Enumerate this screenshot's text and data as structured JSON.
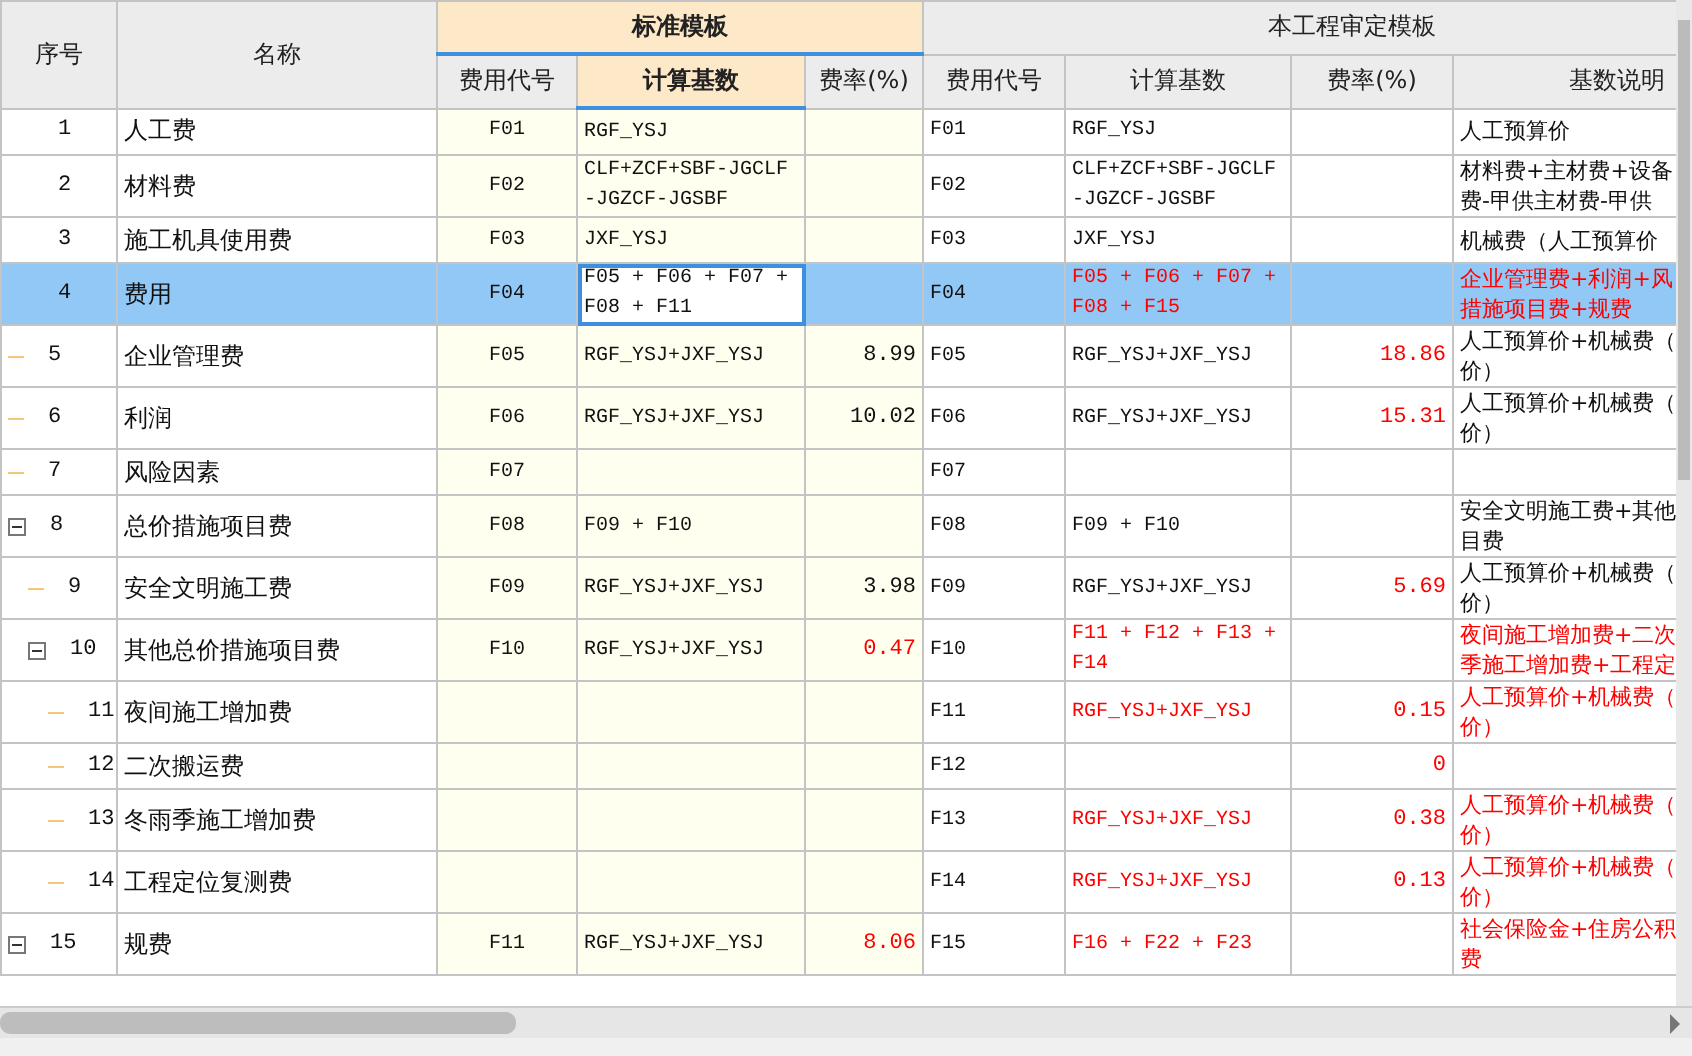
{
  "table": {
    "columns": [
      {
        "label": "序号"
      },
      {
        "label": "名称"
      }
    ],
    "groups": [
      {
        "label": "标准模板",
        "highlighted": true,
        "columns": [
          {
            "label": "费用代号",
            "highlighted": false
          },
          {
            "label": "计算基数",
            "highlighted": true
          },
          {
            "label": "费率(%)",
            "highlighted": false
          }
        ]
      },
      {
        "label": "本工程审定模板",
        "highlighted": false,
        "columns": [
          {
            "label": "费用代号",
            "highlighted": false
          },
          {
            "label": "计算基数",
            "highlighted": false
          },
          {
            "label": "费率(%)",
            "highlighted": false
          },
          {
            "label": "基数说明",
            "highlighted": false
          }
        ]
      }
    ],
    "rows": [
      {
        "seq": "1",
        "name": "人工费",
        "std_code": "F01",
        "std_base": "RGF_YSJ",
        "code": "F01",
        "base": {
          "text": "RGF_YSJ",
          "red": false
        },
        "desc": {
          "lines": [
            "人工预算价"
          ],
          "red": false
        },
        "selected": false,
        "editing": false
      },
      {
        "seq": "2",
        "name": "材料费",
        "std_code": "F02",
        "std_base": "CLF+ZCF+SBF-JGCLF-JGZCF-JGSBF",
        "code": "F02",
        "base": {
          "text": "CLF+ZCF+SBF-JGCLF-JGZCF-JGSBF",
          "red": false
        },
        "desc": {
          "lines": [
            "材料费+主材费+设备",
            "费-甲供主材费-甲供"
          ],
          "red": false
        },
        "selected": false,
        "editing": false
      },
      {
        "seq": "3",
        "name": "施工机具使用费",
        "std_code": "F03",
        "std_base": "JXF_YSJ",
        "code": "F03",
        "base": {
          "text": "JXF_YSJ",
          "red": false
        },
        "desc": {
          "lines": [
            "机械费（人工预算价"
          ],
          "red": false
        },
        "selected": false,
        "editing": false
      },
      {
        "seq": "4",
        "name": "费用",
        "std_code": "F04",
        "std_base": "F05 + F06 + F07 + F08 + F11",
        "code": "F04",
        "base": {
          "text": "F05 + F06 + F07 + F08 + F15",
          "red": true
        },
        "desc": {
          "lines": [
            "企业管理费+利润+风",
            "措施项目费+规费"
          ],
          "red": true
        },
        "selected": true,
        "editing": true,
        "children": [
          {
            "seq": "5",
            "name": "企业管理费",
            "std_code": "F05",
            "std_base": "RGF_YSJ+JXF_YSJ",
            "std_rate": {
              "text": "8.99",
              "red": false
            },
            "code": "F05",
            "base": {
              "text": "RGF_YSJ+JXF_YSJ",
              "red": false
            },
            "rate": {
              "text": "18.86",
              "red": true
            },
            "desc": {
              "lines": [
                "人工预算价+机械费（",
                "价）"
              ],
              "red": false
            },
            "selected": false,
            "editing": false
          },
          {
            "seq": "6",
            "name": "利润",
            "std_code": "F06",
            "std_base": "RGF_YSJ+JXF_YSJ",
            "std_rate": {
              "text": "10.02",
              "red": false
            },
            "code": "F06",
            "base": {
              "text": "RGF_YSJ+JXF_YSJ",
              "red": false
            },
            "rate": {
              "text": "15.31",
              "red": true
            },
            "desc": {
              "lines": [
                "人工预算价+机械费（",
                "价）"
              ],
              "red": false
            },
            "selected": false,
            "editing": false
          },
          {
            "seq": "7",
            "name": "风险因素",
            "std_code": "F07",
            "code": "F07",
            "selected": false,
            "editing": false
          },
          {
            "seq": "8",
            "name": "总价措施项目费",
            "std_code": "F08",
            "std_base": "F09 + F10",
            "code": "F08",
            "base": {
              "text": "F09 + F10",
              "red": false
            },
            "desc": {
              "lines": [
                "安全文明施工费+其他",
                "目费"
              ],
              "red": false
            },
            "selected": false,
            "editing": false,
            "expanded": true,
            "children": [
              {
                "seq": "9",
                "name": "安全文明施工费",
                "std_code": "F09",
                "std_base": "RGF_YSJ+JXF_YSJ",
                "std_rate": {
                  "text": "3.98",
                  "red": false
                },
                "code": "F09",
                "base": {
                  "text": "RGF_YSJ+JXF_YSJ",
                  "red": false
                },
                "rate": {
                  "text": "5.69",
                  "red": true
                },
                "desc": {
                  "lines": [
                    "人工预算价+机械费（",
                    "价）"
                  ],
                  "red": false
                },
                "selected": false,
                "editing": false
              },
              {
                "seq": "10",
                "name": "其他总价措施项目费",
                "std_code": "F10",
                "std_base": "RGF_YSJ+JXF_YSJ",
                "std_rate": {
                  "text": "0.47",
                  "red": true
                },
                "code": "F10",
                "base": {
                  "text": "F11 + F12 + F13 + F14",
                  "red": true
                },
                "desc": {
                  "lines": [
                    "夜间施工增加费+二次",
                    "季施工增加费+工程定"
                  ],
                  "red": true
                },
                "selected": false,
                "editing": false,
                "expanded": true,
                "children": [
                  {
                    "seq": "11",
                    "name": "夜间施工增加费",
                    "code": "F11",
                    "base": {
                      "text": "RGF_YSJ+JXF_YSJ",
                      "red": true
                    },
                    "rate": {
                      "text": "0.15",
                      "red": true
                    },
                    "desc": {
                      "lines": [
                        "人工预算价+机械费（",
                        "价）"
                      ],
                      "red": true
                    },
                    "selected": false,
                    "editing": false
                  },
                  {
                    "seq": "12",
                    "name": "二次搬运费",
                    "code": "F12",
                    "rate": {
                      "text": "0",
                      "red": true
                    },
                    "selected": false,
                    "editing": false
                  },
                  {
                    "seq": "13",
                    "name": "冬雨季施工增加费",
                    "code": "F13",
                    "base": {
                      "text": "RGF_YSJ+JXF_YSJ",
                      "red": true
                    },
                    "rate": {
                      "text": "0.38",
                      "red": true
                    },
                    "desc": {
                      "lines": [
                        "人工预算价+机械费（",
                        "价）"
                      ],
                      "red": true
                    },
                    "selected": false,
                    "editing": false
                  },
                  {
                    "seq": "14",
                    "name": "工程定位复测费",
                    "code": "F14",
                    "base": {
                      "text": "RGF_YSJ+JXF_YSJ",
                      "red": true
                    },
                    "rate": {
                      "text": "0.13",
                      "red": true
                    },
                    "desc": {
                      "lines": [
                        "人工预算价+机械费（",
                        "价）"
                      ],
                      "red": true
                    },
                    "selected": false,
                    "editing": false
                  }
                ]
              }
            ]
          },
          {
            "seq": "15",
            "name": "规费",
            "std_code": "F11",
            "std_base": "RGF_YSJ+JXF_YSJ",
            "std_rate": {
              "text": "8.06",
              "red": true
            },
            "code": "F15",
            "base": {
              "text": "F16 + F22 + F23",
              "red": true
            },
            "desc": {
              "lines": [
                "社会保险金+住房公积",
                "费"
              ],
              "red": true
            },
            "selected": false,
            "editing": false,
            "expanded": true
          }
        ]
      }
    ]
  }
}
